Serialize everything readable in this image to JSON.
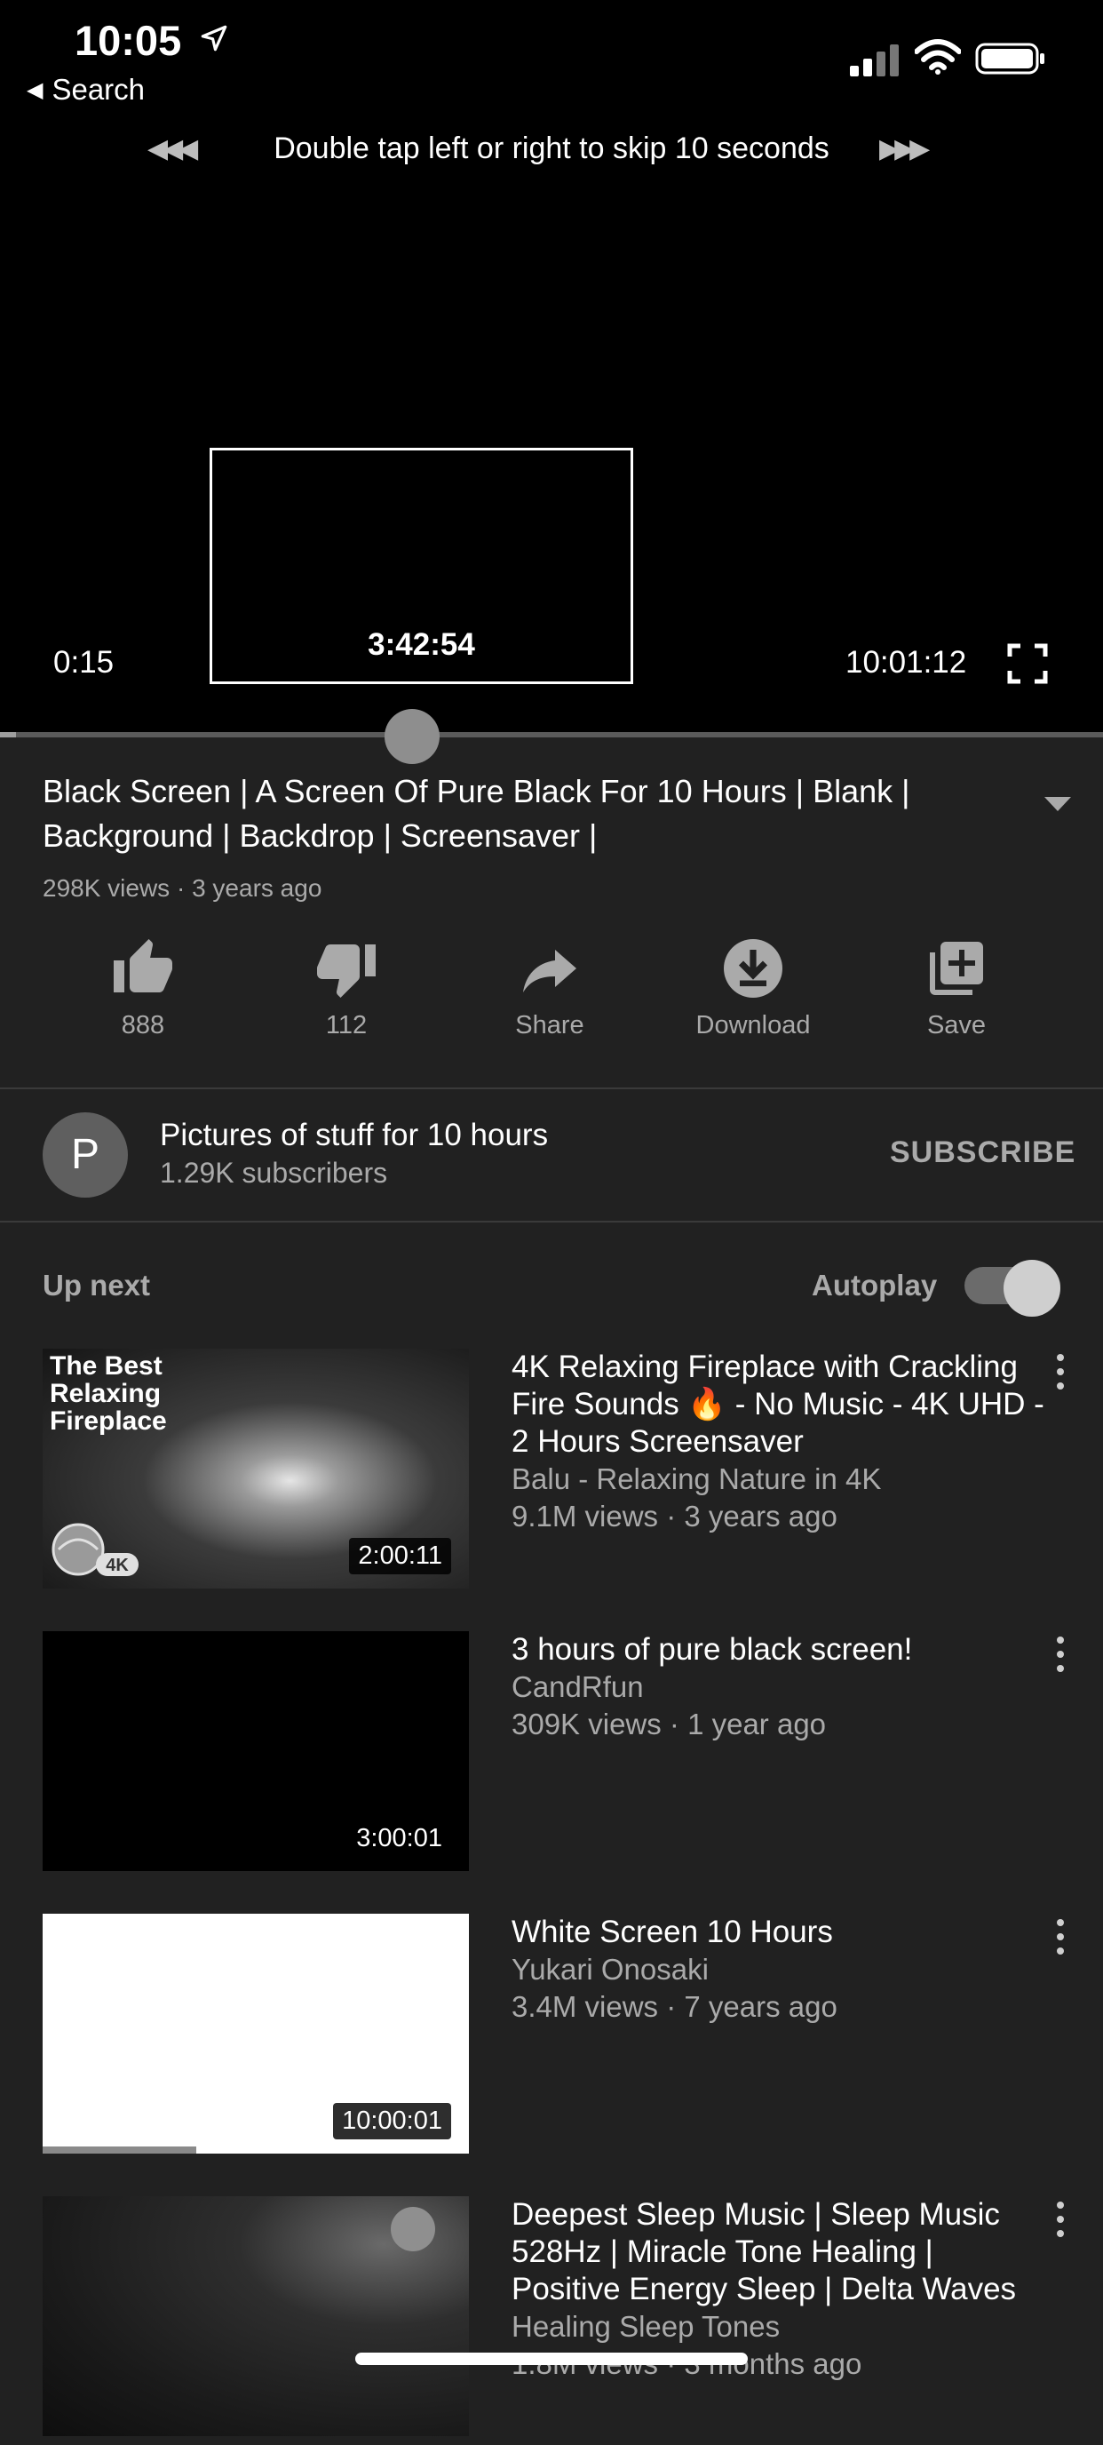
{
  "status_bar": {
    "time": "10:05",
    "back_label": "Search"
  },
  "player": {
    "skip_hint": "Double tap left or right to skip 10 seconds",
    "preview_time": "3:42:54",
    "current_time": "0:15",
    "total_time": "10:01:12",
    "progress": 0.0004
  },
  "video": {
    "title": "Black Screen | A Screen Of Pure Black For 10 Hours | Blank | Background | Backdrop | Screensaver |",
    "meta": "298K views · 3 years ago"
  },
  "actions": [
    {
      "label": "888",
      "icon": "thumbs-up-icon"
    },
    {
      "label": "112",
      "icon": "thumbs-down-icon"
    },
    {
      "label": "Share",
      "icon": "share-icon"
    },
    {
      "label": "Download",
      "icon": "download-icon"
    },
    {
      "label": "Save",
      "icon": "add-to-playlist-icon"
    }
  ],
  "channel": {
    "avatar_letter": "P",
    "name": "Pictures of stuff for 10 hours",
    "subscribers": "1.29K subscribers",
    "subscribe_label": "SUBSCRIBE"
  },
  "up_next": {
    "label": "Up next",
    "autoplay_label": "Autoplay",
    "autoplay_on": true
  },
  "recommendations": [
    {
      "thumb_caption": "The Best\nRelaxing\nFireplace",
      "duration": "2:00:11",
      "title": "4K Relaxing Fireplace with Crackling Fire Sounds 🔥 - No Music - 4K UHD - 2 Hours Screensaver",
      "channel": "Balu - Relaxing Nature in 4K",
      "views": "9.1M views · 3 years ago"
    },
    {
      "duration": "3:00:01",
      "title": "3 hours of pure black screen!",
      "channel": "CandRfun",
      "views": "309K views · 1 year ago"
    },
    {
      "duration": "10:00:01",
      "title": "White Screen 10 Hours",
      "channel": "Yukari Onosaki",
      "views": "3.4M views · 7 years ago",
      "watched_progress": 0.36
    },
    {
      "title": "Deepest Sleep Music | Sleep Music 528Hz | Miracle Tone Healing | Positive Energy Sleep | Delta Waves",
      "channel": "Healing Sleep Tones",
      "views": "1.8M views · 3 months ago"
    }
  ]
}
